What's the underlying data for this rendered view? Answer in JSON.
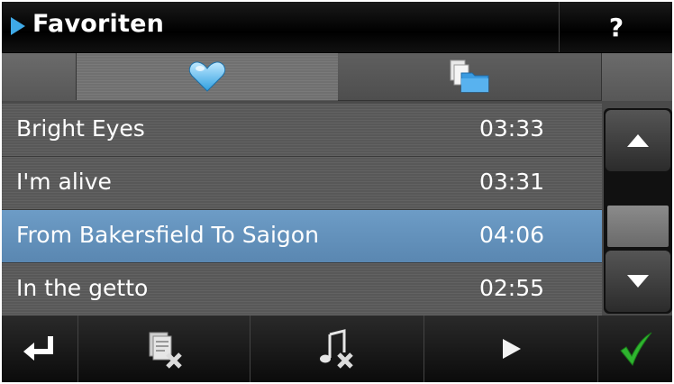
{
  "header": {
    "title": "Favoriten",
    "help_label": "?",
    "accent_color": "#3fa9e6"
  },
  "tabs": [
    {
      "icon": "heart-icon",
      "active": true
    },
    {
      "icon": "folder-files-icon",
      "active": false
    }
  ],
  "list": {
    "items": [
      {
        "name": "Bright Eyes",
        "duration": "03:33",
        "selected": false
      },
      {
        "name": "I'm alive",
        "duration": "03:31",
        "selected": false
      },
      {
        "name": "From Bakersfield To Saigon",
        "duration": "04:06",
        "selected": true
      },
      {
        "name": "In the getto",
        "duration": "02:55",
        "selected": false
      }
    ],
    "selection_color": "#6d9cc6"
  },
  "scrollbar": {
    "up_icon": "arrow-up-icon",
    "down_icon": "arrow-down-icon"
  },
  "toolbar": {
    "buttons": [
      {
        "icon": "return-arrow-icon"
      },
      {
        "icon": "delete-file-icon"
      },
      {
        "icon": "delete-music-icon"
      },
      {
        "icon": "play-icon"
      },
      {
        "icon": "checkmark-icon",
        "color": "#2fb52f"
      }
    ]
  }
}
